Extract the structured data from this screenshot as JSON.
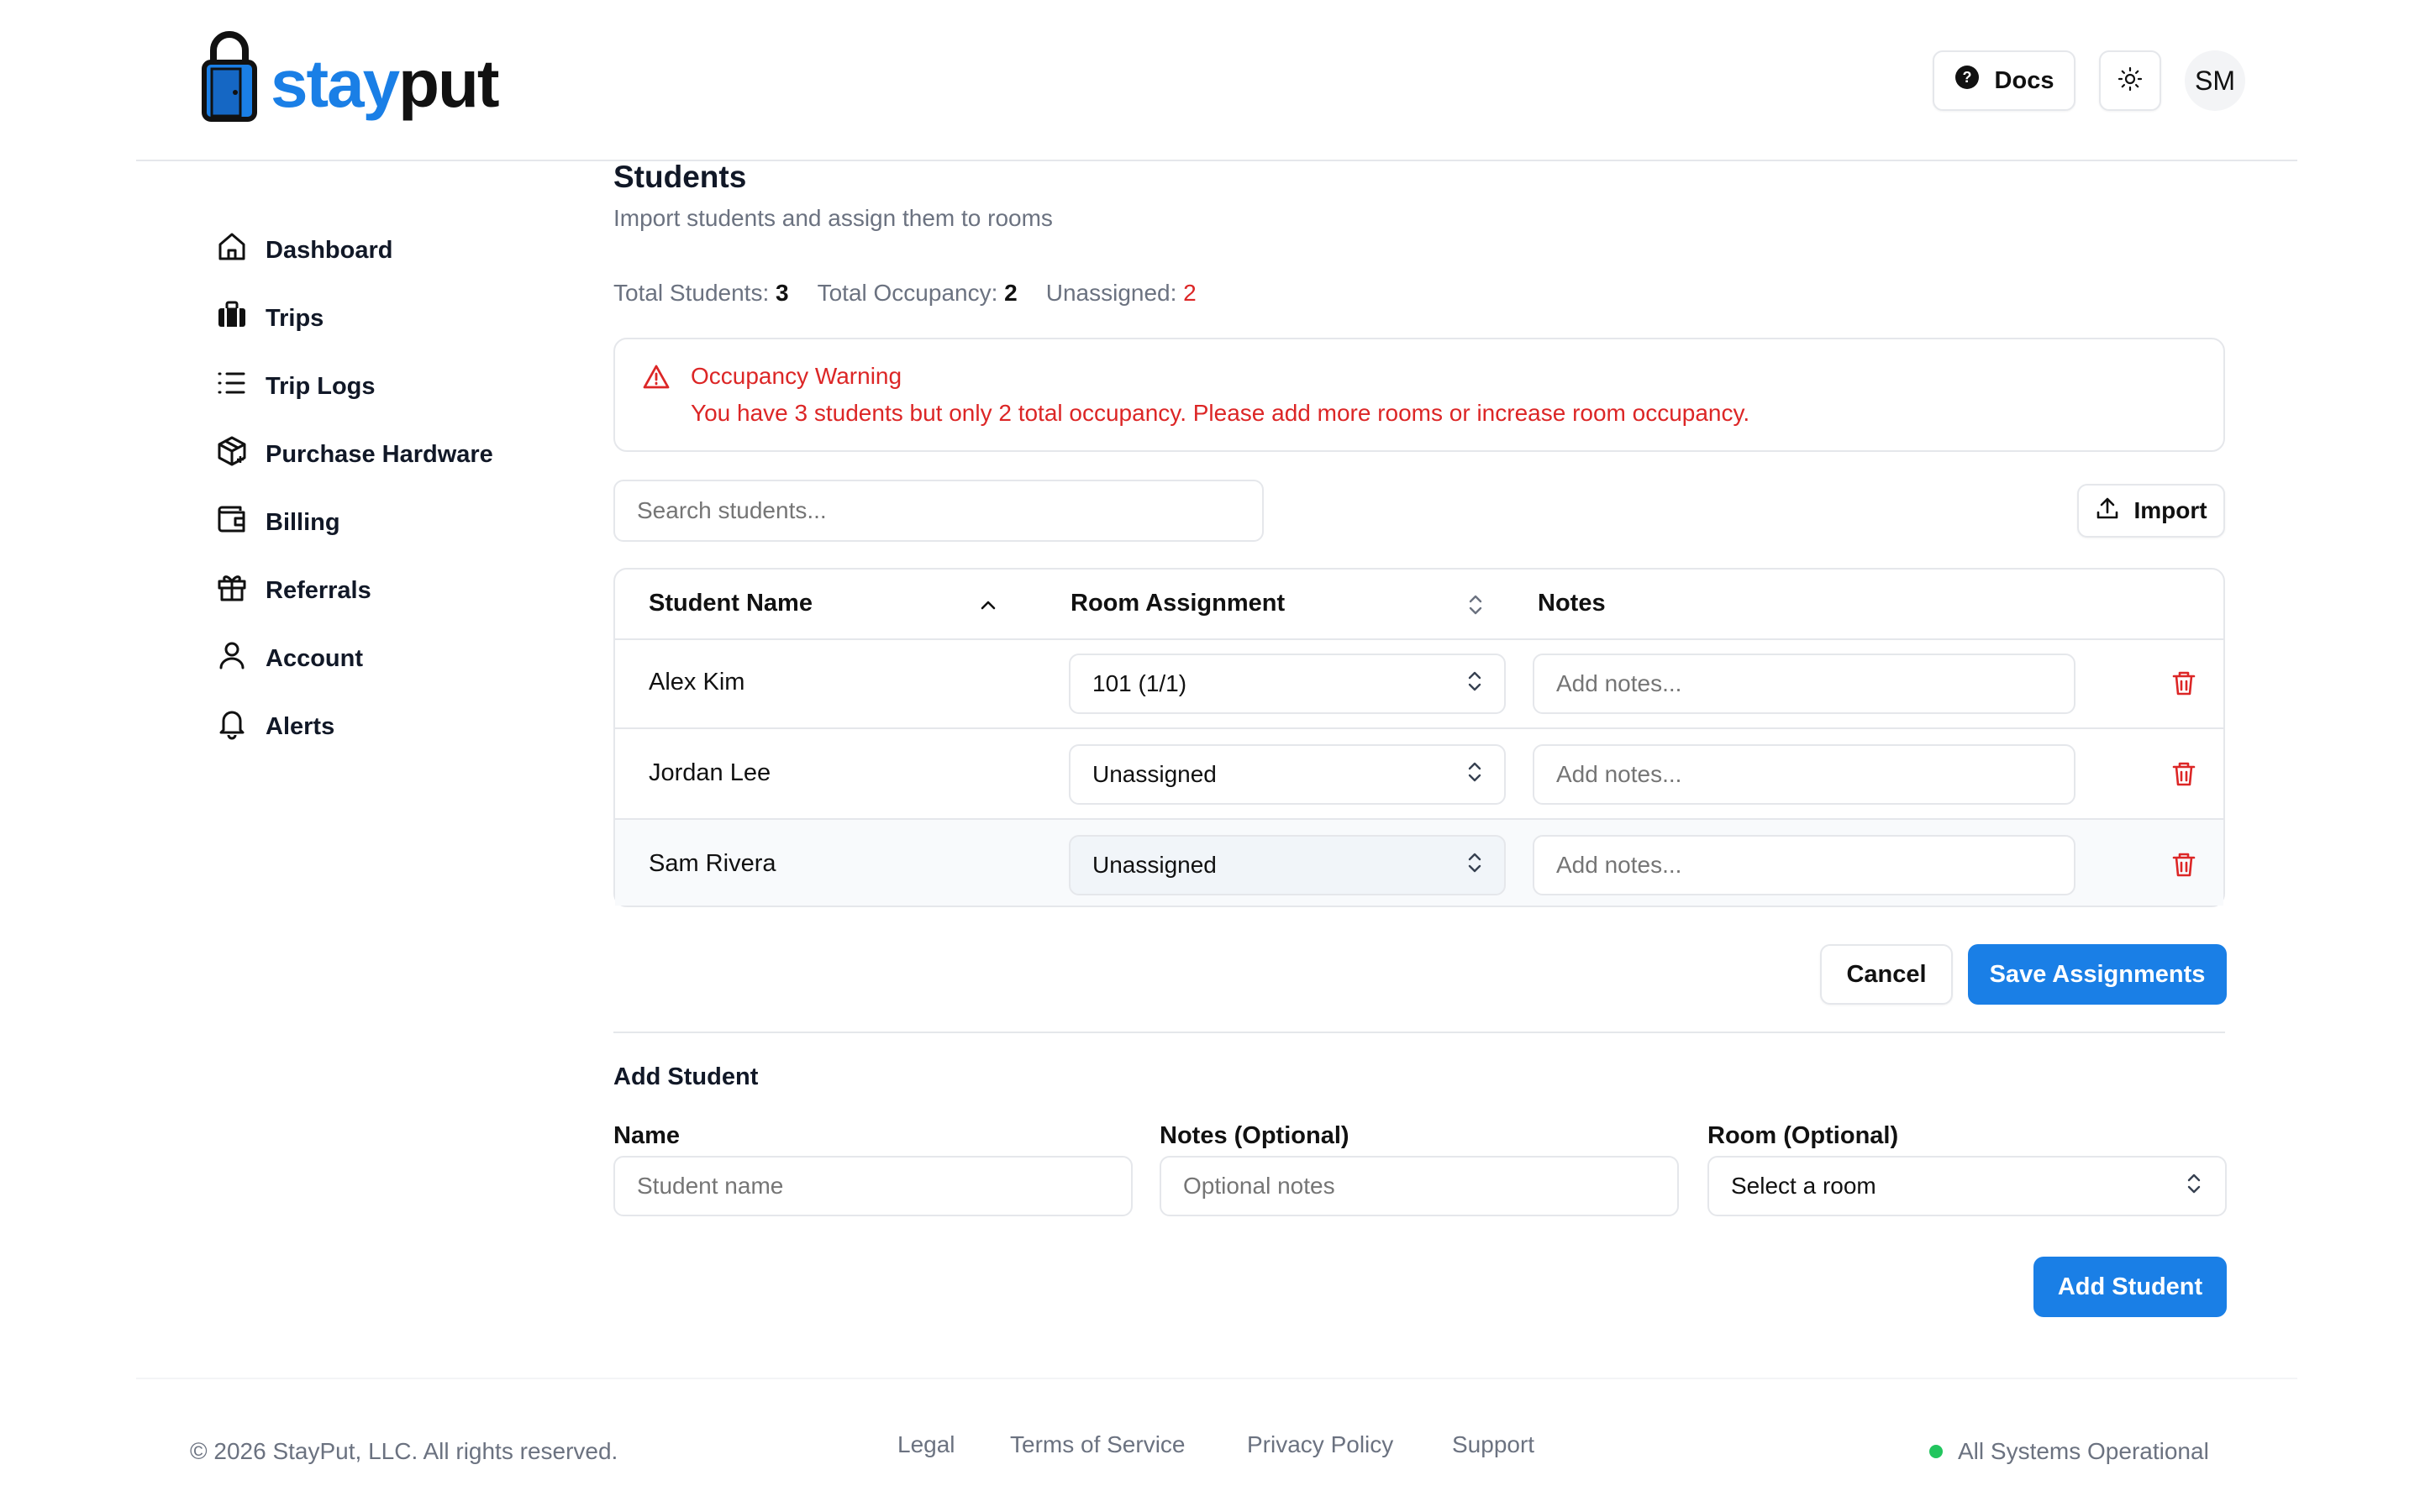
{
  "brand": {
    "name_part1": "stay",
    "name_part2": "put",
    "icon": "lock-icon",
    "color": "#1a7fe6"
  },
  "header": {
    "docs_label": "Docs",
    "docs_icon": "help-circle-icon",
    "theme_icon": "sun-icon",
    "avatar_initials": "SM"
  },
  "sidebar": {
    "items": [
      {
        "label": "Dashboard",
        "icon": "home-icon"
      },
      {
        "label": "Trips",
        "icon": "luggage-icon"
      },
      {
        "label": "Trip Logs",
        "icon": "list-icon"
      },
      {
        "label": "Purchase Hardware",
        "icon": "package-plus-icon"
      },
      {
        "label": "Billing",
        "icon": "wallet-icon"
      },
      {
        "label": "Referrals",
        "icon": "gift-icon"
      },
      {
        "label": "Account",
        "icon": "user-icon"
      },
      {
        "label": "Alerts",
        "icon": "bell-icon"
      }
    ]
  },
  "page": {
    "title": "Students",
    "subtitle": "Import students and assign them to rooms"
  },
  "stats": {
    "total_students_label": "Total Students:",
    "total_students": "3",
    "total_occupancy_label": "Total Occupancy:",
    "total_occupancy": "2",
    "unassigned_label": "Unassigned:",
    "unassigned": "2"
  },
  "warning": {
    "title": "Occupancy Warning",
    "message": "You have 3 students but only 2 total occupancy. Please add more rooms or increase room occupancy.",
    "color": "#dc2626"
  },
  "search": {
    "placeholder": "Search students..."
  },
  "import_label": "Import",
  "table": {
    "headers": {
      "name": "Student Name",
      "room": "Room Assignment",
      "notes": "Notes"
    },
    "rows": [
      {
        "name": "Alex Kim",
        "room": "101 (1/1)",
        "notes_placeholder": "Add notes..."
      },
      {
        "name": "Jordan Lee",
        "room": "Unassigned",
        "notes_placeholder": "Add notes..."
      },
      {
        "name": "Sam Rivera",
        "room": "Unassigned",
        "notes_placeholder": "Add notes..."
      }
    ]
  },
  "actions": {
    "cancel": "Cancel",
    "save": "Save Assignments"
  },
  "add_student": {
    "title": "Add Student",
    "name_label": "Name",
    "name_placeholder": "Student name",
    "notes_label": "Notes (Optional)",
    "notes_placeholder": "Optional notes",
    "room_label": "Room (Optional)",
    "room_value": "Select a room",
    "button": "Add Student"
  },
  "footer": {
    "copyright": "© 2026 StayPut, LLC. All rights reserved.",
    "links": [
      "Legal",
      "Terms of Service",
      "Privacy Policy",
      "Support"
    ],
    "status": "All Systems Operational",
    "status_color": "#22c55e"
  }
}
